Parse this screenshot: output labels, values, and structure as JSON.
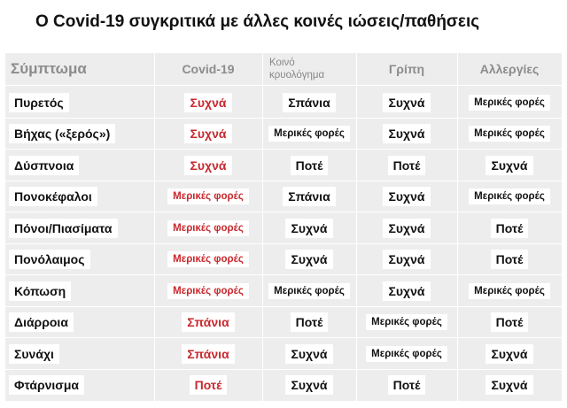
{
  "title": "Ο Covid-19 συγκριτικά με άλλες κοινές ιώσεις/παθήσεις",
  "headers": {
    "symptom": "Σύμπτωμα",
    "covid": "Covid-19",
    "cold_line1": "Κοινό",
    "cold_line2": "κρυολόγημα",
    "flu": "Γρίπη",
    "allergy": "Αλλεργίες"
  },
  "colors": {
    "accent_red": "#c8282d",
    "header_gray": "#8c8c8c",
    "table_bg": "#ededed"
  },
  "rows": [
    {
      "symptom": "Πυρετός",
      "covid": "Συχνά",
      "cold": "Σπάνια",
      "flu": "Συχνά",
      "allergy": "Μερικές φορές"
    },
    {
      "symptom": "Βήχας («ξερός»)",
      "covid": "Συχνά",
      "cold": "Μερικές φορές",
      "flu": "Συχνά",
      "allergy": "Μερικές φορές"
    },
    {
      "symptom": "Δύσπνοια",
      "covid": "Συχνά",
      "cold": "Ποτέ",
      "flu": "Ποτέ",
      "allergy": "Συχνά"
    },
    {
      "symptom": "Πονοκέφαλοι",
      "covid": "Μερικές φορές",
      "cold": "Σπάνια",
      "flu": "Συχνά",
      "allergy": "Μερικές φορές"
    },
    {
      "symptom": "Πόνοι/Πιασίματα",
      "covid": "Μερικές φορές",
      "cold": "Συχνά",
      "flu": "Συχνά",
      "allergy": "Ποτέ"
    },
    {
      "symptom": "Πονόλαιμος",
      "covid": "Μερικές φορές",
      "cold": "Συχνά",
      "flu": "Συχνά",
      "allergy": "Ποτέ"
    },
    {
      "symptom": "Κόπωση",
      "covid": "Μερικές φορές",
      "cold": "Μερικές φορές",
      "flu": "Συχνά",
      "allergy": "Μερικές φορές"
    },
    {
      "symptom": "Διάρροια",
      "covid": "Σπάνια",
      "cold": "Ποτέ",
      "flu": "Μερικές φορές",
      "allergy": "Ποτέ"
    },
    {
      "symptom": "Συνάχι",
      "covid": "Σπάνια",
      "cold": "Συχνά",
      "flu": "Μερικές φορές",
      "allergy": "Συχνά"
    },
    {
      "symptom": "Φτάρνισμα",
      "covid": "Ποτέ",
      "cold": "Συχνά",
      "flu": "Ποτέ",
      "allergy": "Συχνά"
    }
  ]
}
